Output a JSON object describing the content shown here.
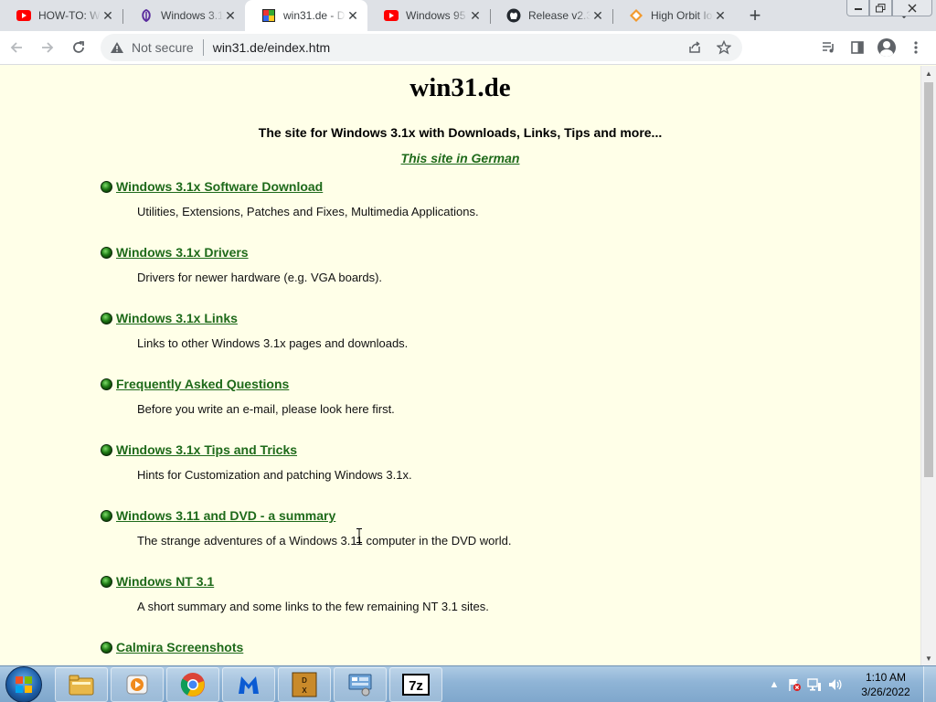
{
  "browser": {
    "tabs": [
      {
        "title": "HOW-TO: W",
        "icon": "youtube-icon",
        "active": false
      },
      {
        "title": "Windows 3.1",
        "icon": "feather-icon",
        "active": false
      },
      {
        "title": "win31.de - D",
        "icon": "win31-flag-icon",
        "active": true
      },
      {
        "title": "Windows 95",
        "icon": "youtube-icon",
        "active": false
      },
      {
        "title": "Release v2.3",
        "icon": "github-icon",
        "active": false
      },
      {
        "title": "High Orbit Io",
        "icon": "diamond-icon",
        "active": false
      }
    ],
    "new_tab_symbol": "+",
    "address": {
      "security_label": "Not secure",
      "url": "win31.de/eindex.htm"
    }
  },
  "page": {
    "title": "win31.de",
    "tagline": "The site for Windows 3.1x with Downloads, Links, Tips and more...",
    "german_link": "This site in German",
    "entries": [
      {
        "link": "Windows 3.1x Software Download",
        "desc": "Utilities, Extensions, Patches and Fixes, Multimedia Applications."
      },
      {
        "link": "Windows 3.1x Drivers",
        "desc": "Drivers for newer hardware (e.g. VGA boards)."
      },
      {
        "link": "Windows 3.1x Links",
        "desc": "Links to other Windows 3.1x pages and downloads."
      },
      {
        "link": "Frequently Asked Questions",
        "desc": "Before you write an e-mail, please look here first."
      },
      {
        "link": "Windows 3.1x Tips and Tricks",
        "desc": "Hints for Customization and patching Windows 3.1x."
      },
      {
        "link": "Windows 3.11 and DVD - a summary",
        "desc": "The strange adventures of a Windows 3.11 computer in the DVD world."
      },
      {
        "link": "Windows NT 3.1",
        "desc": "A short summary and some links to the few remaining NT 3.1 sites."
      },
      {
        "link": "Calmira Screenshots",
        "desc": ""
      }
    ],
    "link_color": "#1e6a1a",
    "background_color": "#ffffe8"
  },
  "taskbar": {
    "pinned": [
      "file-explorer-icon",
      "media-player-icon",
      "chrome-icon",
      "malwarebytes-icon",
      "dosbox-icon",
      "control-panel-icon",
      "7zip-icon"
    ],
    "clock_time": "1:10 AM",
    "clock_date": "3/26/2022"
  }
}
